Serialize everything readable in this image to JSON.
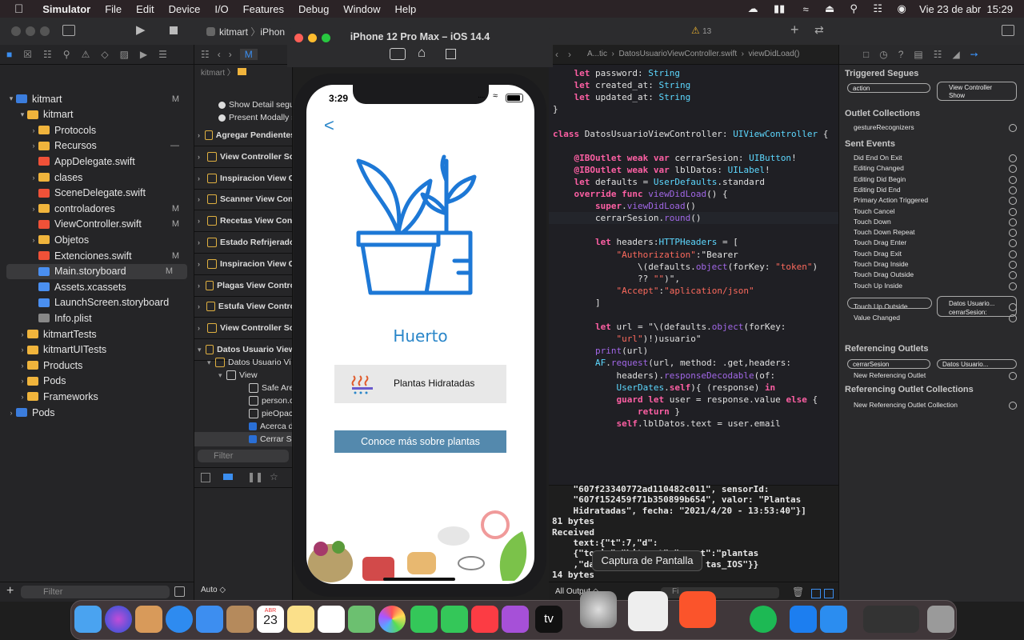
{
  "menubar": {
    "app": "Simulator",
    "items": [
      "File",
      "Edit",
      "Device",
      "I/O",
      "Features",
      "Debug",
      "Window",
      "Help"
    ],
    "datetime": "Vie 23 de abr  15:29"
  },
  "toolbar": {
    "scheme": "kitmart",
    "scheme2": "iPhon",
    "warnings": "13"
  },
  "simulator": {
    "title": "iPhone 12 Pro Max – iOS 14.4",
    "time": "3:29",
    "back": "<",
    "app_title": "Huerto",
    "card_label": "Plantas Hidratadas",
    "button": "Conoce más sobre plantas"
  },
  "navigator": {
    "filter": "Filter",
    "items": [
      {
        "label": "kitmart",
        "badge": "M",
        "type": "proj",
        "depth": 0,
        "disc": "▾"
      },
      {
        "label": "kitmart",
        "badge": "",
        "type": "folder",
        "depth": 1,
        "disc": "▾"
      },
      {
        "label": "Protocols",
        "badge": "",
        "type": "folder",
        "depth": 2,
        "disc": "›"
      },
      {
        "label": "Recursos",
        "badge": "—",
        "type": "folder",
        "depth": 2,
        "disc": "›"
      },
      {
        "label": "AppDelegate.swift",
        "badge": "",
        "type": "swiftf",
        "depth": 2,
        "disc": ""
      },
      {
        "label": "clases",
        "badge": "",
        "type": "folder",
        "depth": 2,
        "disc": "›"
      },
      {
        "label": "SceneDelegate.swift",
        "badge": "",
        "type": "swiftf",
        "depth": 2,
        "disc": ""
      },
      {
        "label": "controladores",
        "badge": "M",
        "type": "folder",
        "depth": 2,
        "disc": "›"
      },
      {
        "label": "ViewController.swift",
        "badge": "M",
        "type": "swiftf",
        "depth": 2,
        "disc": ""
      },
      {
        "label": "Objetos",
        "badge": "",
        "type": "folder",
        "depth": 2,
        "disc": "›"
      },
      {
        "label": "Extenciones.swift",
        "badge": "M",
        "type": "swiftf",
        "depth": 2,
        "disc": ""
      },
      {
        "label": "Main.storyboard",
        "badge": "M",
        "type": "sbf",
        "depth": 2,
        "disc": "",
        "sel": true
      },
      {
        "label": "Assets.xcassets",
        "badge": "",
        "type": "sbf",
        "depth": 2,
        "disc": ""
      },
      {
        "label": "LaunchScreen.storyboard",
        "badge": "",
        "type": "sbf",
        "depth": 2,
        "disc": ""
      },
      {
        "label": "Info.plist",
        "badge": "",
        "type": "plist",
        "depth": 2,
        "disc": ""
      },
      {
        "label": "kitmartTests",
        "badge": "",
        "type": "folder",
        "depth": 1,
        "disc": "›"
      },
      {
        "label": "kitmartUITests",
        "badge": "",
        "type": "folder",
        "depth": 1,
        "disc": "›"
      },
      {
        "label": "Products",
        "badge": "",
        "type": "folder",
        "depth": 1,
        "disc": "›"
      },
      {
        "label": "Pods",
        "badge": "",
        "type": "folder",
        "depth": 1,
        "disc": "›"
      },
      {
        "label": "Frameworks",
        "badge": "",
        "type": "folder",
        "depth": 1,
        "disc": "›"
      },
      {
        "label": "Pods",
        "badge": "",
        "type": "proj",
        "depth": 0,
        "disc": "›"
      }
    ]
  },
  "outline": {
    "top": [
      "Show Detail segue",
      "Present Modally se"
    ],
    "scenes": [
      "Agregar Pendientes",
      "View Controller Sc",
      "Inspiracion View C",
      "Scanner View Con",
      "Recetas View Con",
      "Estado Refrijerado",
      "Inspiracion View C",
      "Plagas View Contro",
      "Estufa View Contro",
      "View Controller Sc",
      "Datos Usuario View"
    ],
    "children": [
      "Datos Usuario Vi",
      "View",
      "Safe Area",
      "person.circ",
      "pieOpacida",
      "Acerca de.",
      "Cerrar Ses"
    ],
    "filter": "Filter"
  },
  "code": [
    "    let password: String",
    "    let created_at: String",
    "    let updated_at: String",
    "}",
    "",
    "class DatosUsuarioViewController: UIViewController {",
    "",
    "    @IBOutlet weak var cerrarSesion: UIButton!",
    "    @IBOutlet weak var lblDatos: UILabel!",
    "    let defaults = UserDefaults.standard",
    "    override func viewDidLoad() {",
    "        super.viewDidLoad()",
    "        cerrarSesion.round()",
    "",
    "        let headers:HTTPHeaders = [",
    "            \"Authorization\":\"Bearer",
    "                \\(defaults.object(forKey: \"token\")",
    "                ?? \"\")\",",
    "            \"Accept\":\"aplication/json\"",
    "        ]",
    "",
    "        let url = \"\\(defaults.object(forKey:",
    "            \"url\")!)usuario\"",
    "        print(url)",
    "        AF.request(url, method: .get,headers:",
    "            headers).responseDecodable(of:",
    "            UserDates.self){ (response) in",
    "            guard let user = response.value else {",
    "                return }",
    "            self.lblDatos.text = user.email"
  ],
  "editor": {
    "breadcrumb": "A...tic  ›  DatosUsuarioViewController.swift  ›  viewDidLoad()"
  },
  "console": [
    "    \"607f23340772ad110482c011\", sensorId:",
    "    \"607f152459f71b350899b654\", valor: \"Plantas",
    "    Hidratadas\", fecha: \"2021/4/20 - 13:53:40\"}]",
    "81 bytes",
    "Received",
    "    text:{\"t\":7,\"d\":",
    "    {\"topic\":\"kitmart\",\"event\":\"plantas",
    "    ,\"da                     tas_IOS\"}}",
    "14 bytes"
  ],
  "console_footer": {
    "auto": "Auto ◇",
    "all_output": "All Output ◇",
    "filter": "Fi"
  },
  "inspector": {
    "triggered": "Triggered Segues",
    "action": "action",
    "vc_show": [
      "View Controller",
      "Show"
    ],
    "outlet_collections": "Outlet Collections",
    "gesture": "gestureRecognizers",
    "sent_events": "Sent Events",
    "events": [
      "Did End On Exit",
      "Editing Changed",
      "Editing Did Begin",
      "Editing Did End",
      "Primary Action Triggered",
      "Touch Cancel",
      "Touch Down",
      "Touch Down Repeat",
      "Touch Drag Enter",
      "Touch Drag Exit",
      "Touch Drag Inside",
      "Touch Drag Outside",
      "Touch Up Inside",
      "",
      "Touch Up Outside",
      "Value Changed"
    ],
    "touch_up_target": [
      "Datos Usuario...",
      "cerrarSesion:"
    ],
    "referencing_outlets": "Referencing Outlets",
    "cerrar": "cerrarSesion",
    "datos_usuario": "Datos Usuario...",
    "new_ref": "New Referencing Outlet",
    "ref_collections": "Referencing Outlet Collections",
    "new_ref_coll": "New Referencing Outlet Collection"
  },
  "tooltip": "Captura de Pantalla",
  "dock": {
    "calendar_month": "ABR",
    "calendar_day": "23",
    "tv": "tv"
  }
}
